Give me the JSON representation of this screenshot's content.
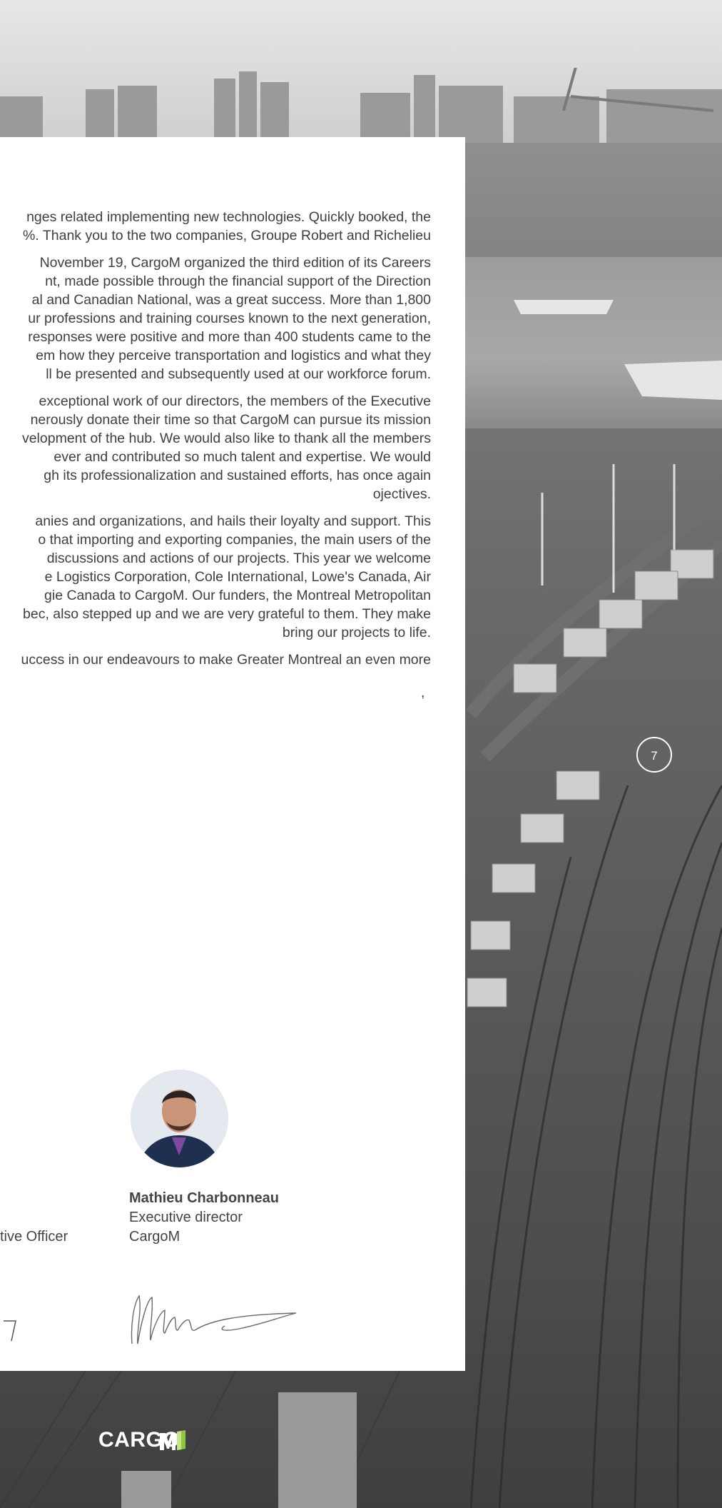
{
  "page_number": "7",
  "paragraphs": [
    [
      "nges related implementing new technologies. Quickly booked, the",
      "%. Thank you to the two companies, Groupe Robert and Richelieu"
    ],
    [
      "November 19, CargoM organized the third edition of its Careers",
      "nt, made possible through the financial support of the Direction",
      "al and Canadian National, was a great success. More than 1,800",
      "ur professions and training courses known to the next generation,",
      "responses were positive and more than 400 students came to the",
      "em how they perceive transportation and logistics and what they",
      "ll be presented and subsequently used at our workforce forum."
    ],
    [
      "exceptional work of our directors, the members of the Executive",
      "nerously donate their time so that CargoM can pursue its mission",
      "velopment of the hub. We would also like to thank all the members",
      "ever and contributed so much talent and expertise. We would",
      "gh its professionalization and sustained efforts, has once again",
      "ojectives."
    ],
    [
      "anies and organizations, and hails their loyalty and support. This",
      "o that importing and exporting companies, the main users of the",
      "discussions and actions of our projects. This year we welcome",
      "e Logistics Corporation, Cole International, Lowe's Canada, Air",
      "gie Canada to CargoM. Our funders, the Montreal Metropolitan",
      "bec, also stepped up and we are very grateful to them. They make",
      "bring our projects to life."
    ],
    [
      "uccess in our endeavours to make Greater Montreal an even more"
    ],
    [
      ","
    ]
  ],
  "signatory": {
    "name": "Mathieu Charbonneau",
    "title": "Executive director",
    "organization": "CargoM"
  },
  "left_signatory_title_fragment": "tive Officer",
  "logo_text": "CARGOM",
  "colors": {
    "panel": "#ffffff",
    "text": "#3f3f3f",
    "logo": "#ffffff"
  }
}
